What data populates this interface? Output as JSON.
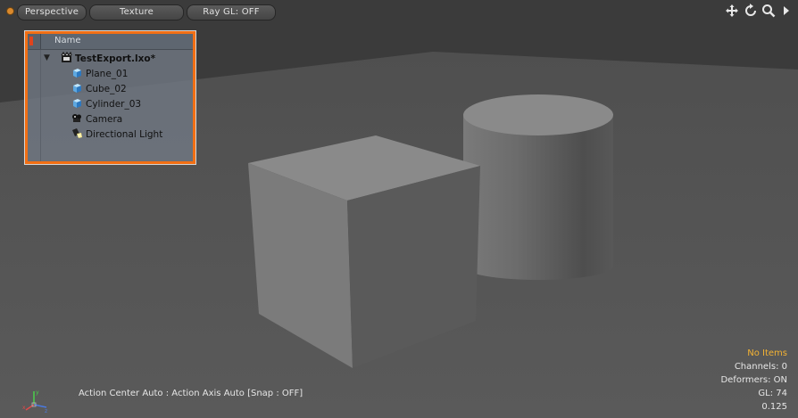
{
  "toolbar": {
    "view_mode": "Perspective",
    "shading_mode": "Texture",
    "ray_gl": "Ray GL: OFF",
    "icons": [
      "move-view-icon",
      "rotate-view-icon",
      "zoom-view-icon",
      "expand-menu-icon"
    ]
  },
  "items_list": {
    "column_header": "Name",
    "scene_name": "TestExport.lxo*",
    "items": [
      {
        "label": "Plane_01",
        "icon": "mesh-icon"
      },
      {
        "label": "Cube_02",
        "icon": "mesh-icon"
      },
      {
        "label": "Cylinder_03",
        "icon": "mesh-icon"
      },
      {
        "label": "Camera",
        "icon": "camera-icon"
      },
      {
        "label": "Directional Light",
        "icon": "light-icon"
      }
    ]
  },
  "hud": {
    "selection": "No Items",
    "channels": "Channels: 0",
    "deformers": "Deformers: ON",
    "gl": "GL: 74",
    "timing": "0.125"
  },
  "status_bar": {
    "text": "Action Center Auto : Action Axis Auto  [Snap : OFF]"
  },
  "colors": {
    "accent": "#f26f14",
    "warning_text": "#f3b233",
    "background": "#3c3c3c",
    "floor": "#555555"
  }
}
